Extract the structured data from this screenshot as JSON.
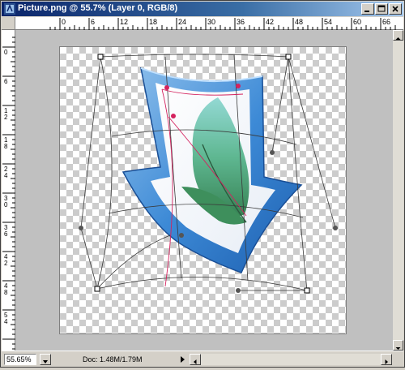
{
  "window": {
    "title": "Picture.png @ 55.7% (Layer 0, RGB/8)"
  },
  "rulers": {
    "horizontal": [
      "0",
      "6",
      "12",
      "18",
      "24",
      "30",
      "36",
      "42",
      "48",
      "54",
      "60",
      "66"
    ],
    "vertical": [
      "0",
      "6",
      "1\n2",
      "1\n8",
      "2\n4",
      "3\n0",
      "3\n6",
      "4\n2",
      "4\n8",
      "5\n4"
    ]
  },
  "status": {
    "zoom": "55.65%",
    "doc": "Doc: 1.48M/1.79M"
  },
  "icons": [
    "photoshop-app-icon",
    "minimize-icon",
    "maximize-icon",
    "close-icon",
    "scroll-up-icon",
    "scroll-down-icon",
    "scroll-left-icon",
    "scroll-right-icon",
    "feather-icon",
    "arrow-icon"
  ]
}
